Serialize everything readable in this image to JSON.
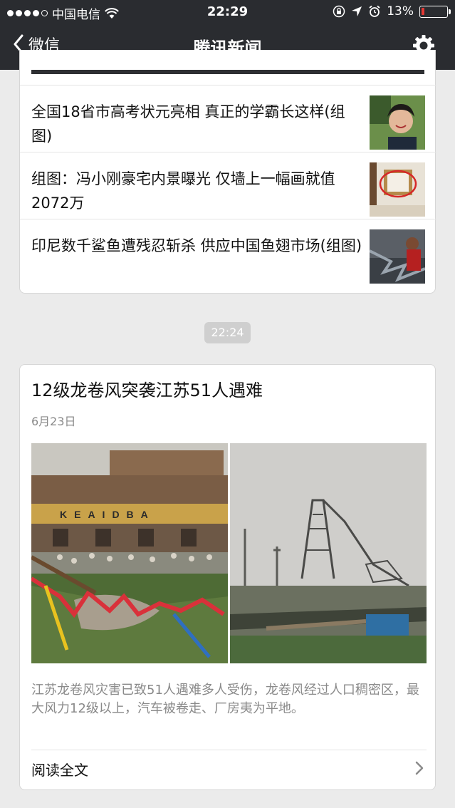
{
  "status_bar": {
    "carrier": "中国电信",
    "time": "22:29",
    "battery_percent": "13%",
    "battery_level": 0.13,
    "colors": {
      "battery_low": "#e53935"
    }
  },
  "nav": {
    "back_label": "微信",
    "title": "腾讯新闻",
    "settings_icon": "gear-icon",
    "background": "#2a2c30"
  },
  "news_list": [
    {
      "title": "全国18省市高考状元亮相 真正的学霸长这样(组图)"
    },
    {
      "title": "组图：冯小刚豪宅内景曝光 仅墙上一幅画就值2072万"
    },
    {
      "title": "印尼数千鲨鱼遭残忍斩杀 供应中国鱼翅市场(组图)"
    }
  ],
  "timestamp": "22:24",
  "featured": {
    "title": "12级龙卷风突袭江苏51人遇难",
    "date": "6月23日",
    "summary": "江苏龙卷风灾害已致51人遇难多人受伤，龙卷风经过人口稠密区，最大风力12级以上，汽车被卷走、厂房夷为平地。",
    "read_more": "阅读全文",
    "sign_text": "KEAIDBA"
  }
}
